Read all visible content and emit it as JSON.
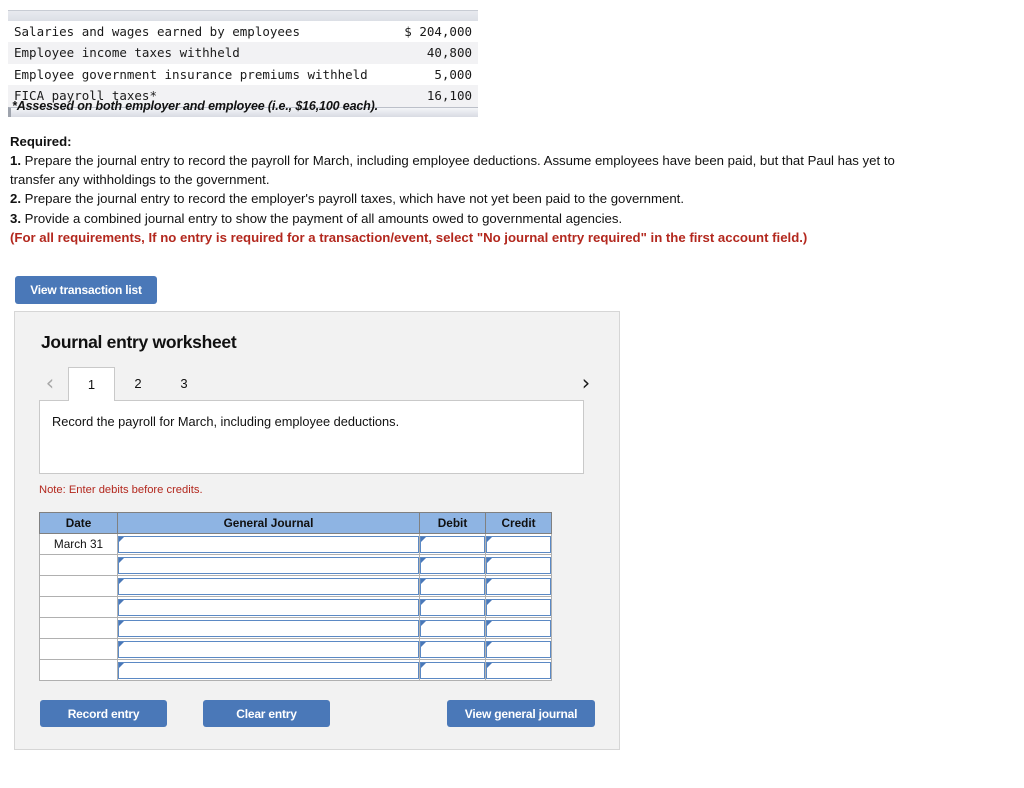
{
  "summary_table": {
    "rows": [
      {
        "label": "Salaries and wages earned by employees",
        "value": "$ 204,000"
      },
      {
        "label": "Employee income taxes withheld",
        "value": "40,800"
      },
      {
        "label": "Employee government insurance premiums withheld",
        "value": "5,000"
      },
      {
        "label": "FICA payroll taxes*",
        "value": "16,100"
      }
    ],
    "footnote": "*Assessed on both employer and employee (i.e., $16,100 each)."
  },
  "required": {
    "heading": "Required:",
    "items": [
      {
        "num": "1.",
        "text": " Prepare the journal entry to record the payroll for March, including employee deductions. Assume employees have been paid, but that Paul has yet to transfer any withholdings to the government."
      },
      {
        "num": "2.",
        "text": " Prepare the journal entry to record the employer's payroll taxes, which have not yet been paid to the government."
      },
      {
        "num": "3.",
        "text": " Provide a combined journal entry to show the payment of all amounts owed to governmental agencies."
      }
    ],
    "red_note": "(For all requirements, If no entry is required for a transaction/event, select \"No journal entry required\" in the first account field.)"
  },
  "toolbar": {
    "view_transaction_list_label": "View transaction list"
  },
  "worksheet": {
    "title": "Journal entry worksheet",
    "tabs": [
      {
        "label": "1",
        "active": true
      },
      {
        "label": "2",
        "active": false
      },
      {
        "label": "3",
        "active": false
      }
    ],
    "prev_icon": "‹",
    "next_icon": "›",
    "description": "Record the payroll for March, including employee deductions.",
    "note": "Note: Enter debits before credits.",
    "table": {
      "headers": [
        "Date",
        "General Journal",
        "Debit",
        "Credit"
      ],
      "rows": [
        {
          "date": "March 31",
          "general_journal": "",
          "debit": "",
          "credit": ""
        },
        {
          "date": "",
          "general_journal": "",
          "debit": "",
          "credit": ""
        },
        {
          "date": "",
          "general_journal": "",
          "debit": "",
          "credit": ""
        },
        {
          "date": "",
          "general_journal": "",
          "debit": "",
          "credit": ""
        },
        {
          "date": "",
          "general_journal": "",
          "debit": "",
          "credit": ""
        },
        {
          "date": "",
          "general_journal": "",
          "debit": "",
          "credit": ""
        },
        {
          "date": "",
          "general_journal": "",
          "debit": "",
          "credit": ""
        }
      ]
    },
    "actions": {
      "record_entry_label": "Record entry",
      "clear_entry_label": "Clear entry",
      "view_general_journal_label": "View general journal"
    }
  },
  "colors": {
    "button_blue": "#4a78b8",
    "table_header_blue": "#8eb4e3",
    "note_red": "#b3281e",
    "panel_gray": "#f2f2f2"
  }
}
